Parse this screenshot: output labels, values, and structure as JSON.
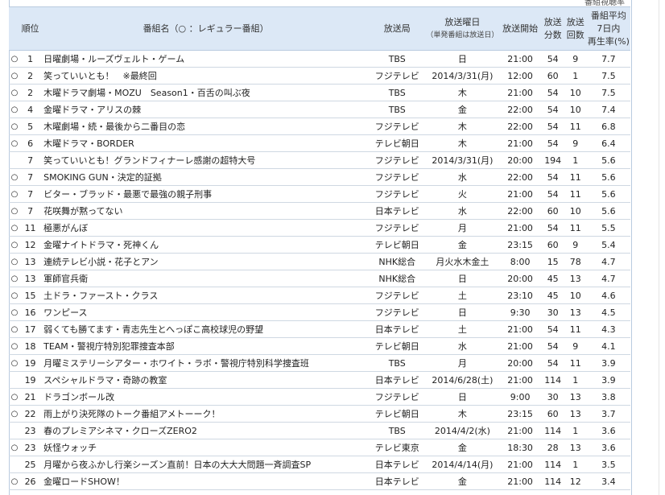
{
  "top_cut_text": "番組視聴率",
  "headers": {
    "rank": "順位",
    "title": "番組名（○ ：レギュラー番組）",
    "station": "放送局",
    "day": "放送曜日",
    "day_sub": "（単発番組は放送日）",
    "start": "放送開始",
    "minutes_1": "放送",
    "minutes_2": "分数",
    "count_1": "放送",
    "count_2": "回数",
    "rate_1": "番組平均",
    "rate_2": "7日内",
    "rate_3": "再生率(%)"
  },
  "rows": [
    {
      "mark": "○",
      "rank": "1",
      "title": "日曜劇場・ルーズヴェルト・ゲーム",
      "station": "TBS",
      "day": "日",
      "start": "21:00",
      "minutes": "54",
      "count": "9",
      "rate": "7.7"
    },
    {
      "mark": "○",
      "rank": "2",
      "title": "笑っていいとも！　※最終回",
      "station": "フジテレビ",
      "day": "2014/3/31(月)",
      "start": "12:00",
      "minutes": "60",
      "count": "1",
      "rate": "7.5"
    },
    {
      "mark": "○",
      "rank": "2",
      "title": "木曜ドラマ劇場・MOZU　Season1・百舌の叫ぶ夜",
      "station": "TBS",
      "day": "木",
      "start": "21:00",
      "minutes": "54",
      "count": "10",
      "rate": "7.5"
    },
    {
      "mark": "○",
      "rank": "4",
      "title": "金曜ドラマ・アリスの棘",
      "station": "TBS",
      "day": "金",
      "start": "22:00",
      "minutes": "54",
      "count": "10",
      "rate": "7.4"
    },
    {
      "mark": "○",
      "rank": "5",
      "title": "木曜劇場・続・最後から二番目の恋",
      "station": "フジテレビ",
      "day": "木",
      "start": "22:00",
      "minutes": "54",
      "count": "11",
      "rate": "6.8"
    },
    {
      "mark": "○",
      "rank": "6",
      "title": "木曜ドラマ・BORDER",
      "station": "テレビ朝日",
      "day": "木",
      "start": "21:00",
      "minutes": "54",
      "count": "9",
      "rate": "6.4"
    },
    {
      "mark": "",
      "rank": "7",
      "title": "笑っていいとも！グランドフィナーレ感謝の超特大号",
      "station": "フジテレビ",
      "day": "2014/3/31(月)",
      "start": "20:00",
      "minutes": "194",
      "count": "1",
      "rate": "5.6"
    },
    {
      "mark": "○",
      "rank": "7",
      "title": "SMOKING GUN・決定的証拠",
      "station": "フジテレビ",
      "day": "水",
      "start": "22:00",
      "minutes": "54",
      "count": "11",
      "rate": "5.6"
    },
    {
      "mark": "○",
      "rank": "7",
      "title": "ビター・ブラッド・最悪で最強の親子刑事",
      "station": "フジテレビ",
      "day": "火",
      "start": "21:00",
      "minutes": "54",
      "count": "11",
      "rate": "5.6"
    },
    {
      "mark": "○",
      "rank": "7",
      "title": "花咲舞が黙ってない",
      "station": "日本テレビ",
      "day": "水",
      "start": "22:00",
      "minutes": "60",
      "count": "10",
      "rate": "5.6"
    },
    {
      "mark": "○",
      "rank": "11",
      "title": "極悪がんぼ",
      "station": "フジテレビ",
      "day": "月",
      "start": "21:00",
      "minutes": "54",
      "count": "11",
      "rate": "5.5"
    },
    {
      "mark": "○",
      "rank": "12",
      "title": "金曜ナイトドラマ・死神くん",
      "station": "テレビ朝日",
      "day": "金",
      "start": "23:15",
      "minutes": "60",
      "count": "9",
      "rate": "5.4"
    },
    {
      "mark": "○",
      "rank": "13",
      "title": "連続テレビ小説・花子とアン",
      "station": "NHK総合",
      "day": "月火水木金土",
      "start": "8:00",
      "minutes": "15",
      "count": "78",
      "rate": "4.7"
    },
    {
      "mark": "○",
      "rank": "13",
      "title": "軍師官兵衛",
      "station": "NHK総合",
      "day": "日",
      "start": "20:00",
      "minutes": "45",
      "count": "13",
      "rate": "4.7"
    },
    {
      "mark": "○",
      "rank": "15",
      "title": "土ドラ・ファースト・クラス",
      "station": "フジテレビ",
      "day": "土",
      "start": "23:10",
      "minutes": "45",
      "count": "10",
      "rate": "4.6"
    },
    {
      "mark": "○",
      "rank": "16",
      "title": "ワンピース",
      "station": "フジテレビ",
      "day": "日",
      "start": "9:30",
      "minutes": "30",
      "count": "13",
      "rate": "4.5"
    },
    {
      "mark": "○",
      "rank": "17",
      "title": "弱くても勝てます・青志先生とへっぽこ高校球児の野望",
      "station": "日本テレビ",
      "day": "土",
      "start": "21:00",
      "minutes": "54",
      "count": "11",
      "rate": "4.3"
    },
    {
      "mark": "○",
      "rank": "18",
      "title": "TEAM・警視庁特別犯罪捜査本部",
      "station": "テレビ朝日",
      "day": "水",
      "start": "21:00",
      "minutes": "54",
      "count": "9",
      "rate": "4.1"
    },
    {
      "mark": "○",
      "rank": "19",
      "title": "月曜ミステリーシアター・ホワイト・ラボ・警視庁特別科学捜査班",
      "station": "TBS",
      "day": "月",
      "start": "20:00",
      "minutes": "54",
      "count": "11",
      "rate": "3.9"
    },
    {
      "mark": "",
      "rank": "19",
      "title": "スペシャルドラマ・奇跡の教室",
      "station": "日本テレビ",
      "day": "2014/6/28(土)",
      "start": "21:00",
      "minutes": "114",
      "count": "1",
      "rate": "3.9"
    },
    {
      "mark": "○",
      "rank": "21",
      "title": "ドラゴンボール改",
      "station": "フジテレビ",
      "day": "日",
      "start": "9:00",
      "minutes": "30",
      "count": "13",
      "rate": "3.8"
    },
    {
      "mark": "○",
      "rank": "22",
      "title": "雨上がり決死隊のトーク番組アメトーーク！",
      "station": "テレビ朝日",
      "day": "木",
      "start": "23:15",
      "minutes": "60",
      "count": "13",
      "rate": "3.7"
    },
    {
      "mark": "",
      "rank": "23",
      "title": "春のプレミアシネマ・クローズZERO2",
      "station": "TBS",
      "day": "2014/4/2(水)",
      "start": "21:00",
      "minutes": "114",
      "count": "1",
      "rate": "3.6"
    },
    {
      "mark": "○",
      "rank": "23",
      "title": "妖怪ウォッチ",
      "station": "テレビ東京",
      "day": "金",
      "start": "18:30",
      "minutes": "28",
      "count": "13",
      "rate": "3.6"
    },
    {
      "mark": "",
      "rank": "25",
      "title": "月曜から夜ふかし行楽シーズン直前！日本の大大大問題一斉調査SP",
      "station": "日本テレビ",
      "day": "2014/4/14(月)",
      "start": "21:00",
      "minutes": "114",
      "count": "1",
      "rate": "3.5"
    },
    {
      "mark": "○",
      "rank": "26",
      "title": "金曜ロードSHOW！",
      "station": "日本テレビ",
      "day": "金",
      "start": "21:00",
      "minutes": "114",
      "count": "12",
      "rate": "3.4"
    }
  ]
}
